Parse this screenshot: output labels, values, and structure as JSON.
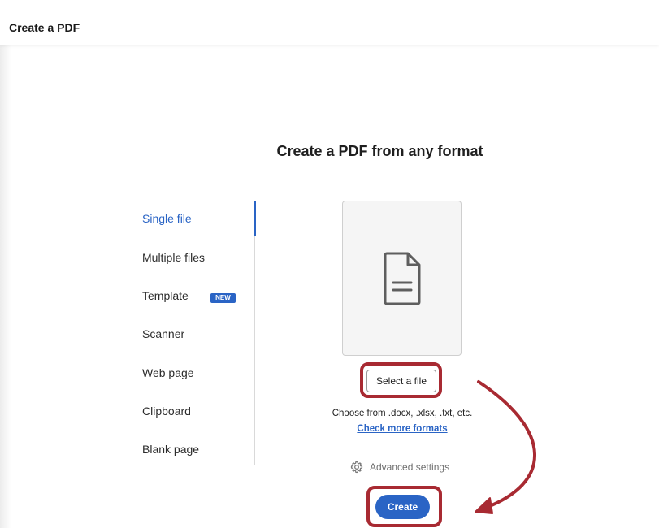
{
  "window": {
    "title": "Create a PDF"
  },
  "main": {
    "heading": "Create a PDF from any format",
    "select_button_label": "Select a file",
    "formats_text": "Choose from .docx, .xlsx, .txt, etc.",
    "more_formats_link": "Check more formats",
    "advanced_settings_label": "Advanced settings",
    "create_button_label": "Create"
  },
  "sidebar": {
    "items": [
      {
        "label": "Single file",
        "active": true
      },
      {
        "label": "Multiple files",
        "active": false
      },
      {
        "label": "Template",
        "active": false,
        "badge": "NEW"
      },
      {
        "label": "Scanner",
        "active": false
      },
      {
        "label": "Web page",
        "active": false
      },
      {
        "label": "Clipboard",
        "active": false
      },
      {
        "label": "Blank page",
        "active": false
      }
    ]
  },
  "icons": {
    "file_box_icon": "document-icon",
    "advanced_icon": "gear-icon"
  },
  "colors": {
    "accent": "#2a64c5",
    "annotation": "#a82a32"
  }
}
